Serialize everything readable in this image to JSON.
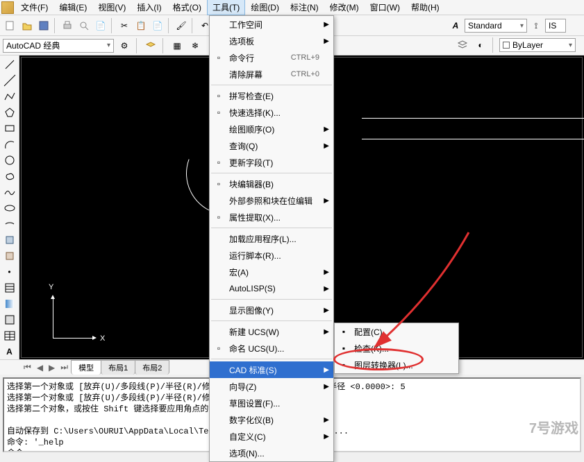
{
  "menubar": {
    "items": [
      "文件(F)",
      "编辑(E)",
      "视图(V)",
      "插入(I)",
      "格式(O)",
      "工具(T)",
      "绘图(D)",
      "标注(N)",
      "修改(M)",
      "窗口(W)",
      "帮助(H)"
    ],
    "active_index": 5
  },
  "workspace_dropdown": "AutoCAD 经典",
  "style_dropdown": "Standard",
  "style_dropdown2": "IS",
  "layer_dropdown": "ByLayer",
  "tools_menu": {
    "items": [
      {
        "label": "工作空间",
        "submenu": true
      },
      {
        "label": "选项板",
        "submenu": true
      },
      {
        "label": "命令行",
        "shortcut": "CTRL+9",
        "icon": "cmd"
      },
      {
        "label": "清除屏幕",
        "shortcut": "CTRL+0"
      },
      {
        "sep": true
      },
      {
        "label": "拼写检查(E)",
        "icon": "abc"
      },
      {
        "label": "快速选择(K)...",
        "icon": "qsel"
      },
      {
        "label": "绘图顺序(O)",
        "submenu": true
      },
      {
        "label": "查询(Q)",
        "submenu": true
      },
      {
        "label": "更新字段(T)",
        "icon": "field"
      },
      {
        "sep": true
      },
      {
        "label": "块编辑器(B)",
        "icon": "block"
      },
      {
        "label": "外部参照和块在位编辑",
        "submenu": true
      },
      {
        "label": "属性提取(X)...",
        "icon": "attr"
      },
      {
        "sep": true
      },
      {
        "label": "加载应用程序(L)..."
      },
      {
        "label": "运行脚本(R)..."
      },
      {
        "label": "宏(A)",
        "submenu": true
      },
      {
        "label": "AutoLISP(S)",
        "submenu": true
      },
      {
        "sep": true
      },
      {
        "label": "显示图像(Y)",
        "submenu": true
      },
      {
        "sep": true
      },
      {
        "label": "新建 UCS(W)",
        "submenu": true
      },
      {
        "label": "命名 UCS(U)...",
        "icon": "ucs"
      },
      {
        "sep": true
      },
      {
        "label": "CAD 标准(S)",
        "submenu": true,
        "highlighted": true
      },
      {
        "label": "向导(Z)",
        "submenu": true
      },
      {
        "label": "草图设置(F)..."
      },
      {
        "label": "数字化仪(B)",
        "submenu": true
      },
      {
        "label": "自定义(C)",
        "submenu": true
      },
      {
        "label": "选项(N)..."
      }
    ]
  },
  "cad_standard_submenu": {
    "items": [
      {
        "label": "配置(C)...",
        "icon": "cfg"
      },
      {
        "label": "检查(K)...",
        "icon": "chk"
      },
      {
        "label": "图层转换器(L)...",
        "icon": "layer"
      }
    ]
  },
  "tabs": {
    "items": [
      "模型",
      "布局1",
      "布局2"
    ],
    "active_index": 0
  },
  "axis": {
    "x": "X",
    "y": "Y"
  },
  "commandline": "选择第一个对象或 [放弃(U)/多段线(P)/半径(R)/修剪(T)/多个(M)]: R 指定圆角半径 <0.0000>: 5\n选择第一个对象或 [放弃(U)/多段线(P)/半径(R)/修剪(T)/多个(M)]:\n选择第二个对象，或按住 Shift 键选择要应用角点的对象:\n\n自动保存到 C:\\Users\\OURUI\\AppData\\Local\\Temp\\Drawing1_1_1_8467.sv$ ...\n命令: '_help\n命令:",
  "watermark": "7号游戏"
}
